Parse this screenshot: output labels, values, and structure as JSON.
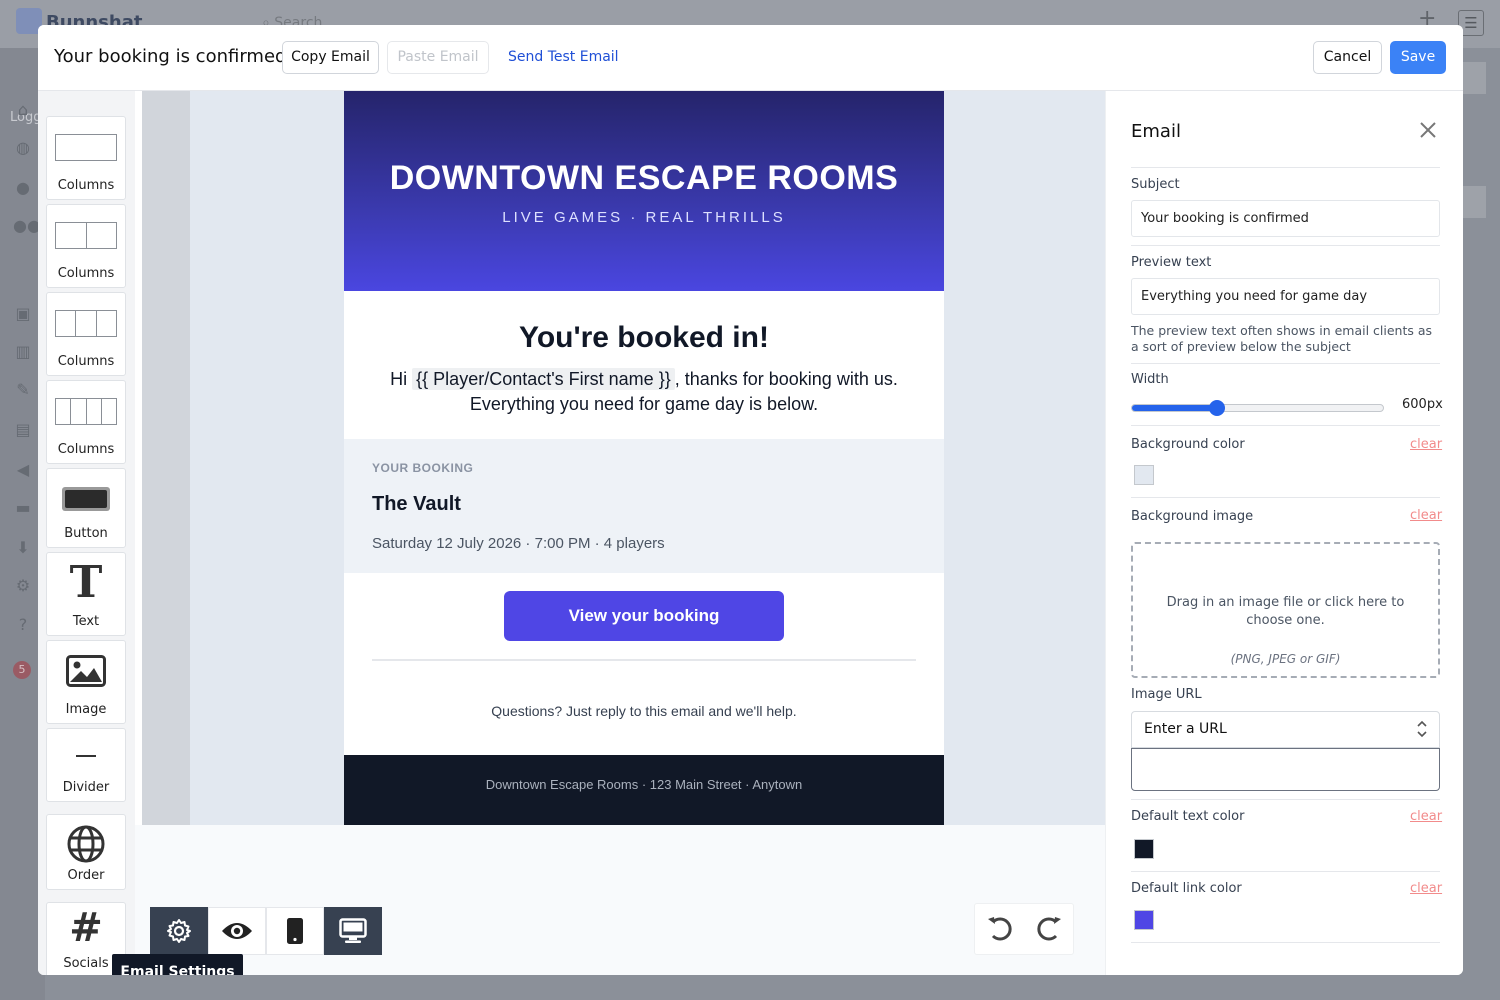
{
  "background_app": {
    "brand": "Bunnshat",
    "search_placeholder": "Search",
    "sidebar_label": "Logg",
    "notification_count": "5",
    "plus": "+",
    "menu": "☰"
  },
  "header": {
    "title": "Your booking is confirmed",
    "copy_email": "Copy Email",
    "paste_email": "Paste Email",
    "send_test": "Send Test Email",
    "cancel": "Cancel",
    "save": "Save"
  },
  "blocks": [
    {
      "label": "Columns",
      "icon": "one-column-icon"
    },
    {
      "label": "Columns",
      "icon": "two-columns-icon"
    },
    {
      "label": "Columns",
      "icon": "three-columns-icon"
    },
    {
      "label": "Columns",
      "icon": "four-columns-icon"
    },
    {
      "label": "Button",
      "icon": "button-icon"
    },
    {
      "label": "Text",
      "icon": "text-icon"
    },
    {
      "label": "Image",
      "icon": "image-icon"
    },
    {
      "label": "Divider",
      "icon": "divider-icon"
    },
    {
      "label": "Order",
      "icon": "globe-icon"
    },
    {
      "label": "Socials",
      "icon": "hash-icon"
    }
  ],
  "email": {
    "hero_title": "DOWNTOWN ESCAPE ROOMS",
    "hero_subtitle": "LIVE GAMES · REAL THRILLS",
    "greeting_title": "You're booked in!",
    "greeting_hi": "Hi",
    "merge_field": "{{  Player/Contact's First name }}",
    "greeting_rest": ", thanks for booking with us.",
    "greeting_line2": "Everything you need for game day is below.",
    "booking_label": "YOUR BOOKING",
    "booking_name": "The Vault",
    "booking_details": "Saturday 12 July 2026  ·  7:00 PM  ·  4 players",
    "cta_label": "View your booking",
    "questions": "Questions? Just reply to this email and we'll help.",
    "footer": "Downtown Escape Rooms  ·  123 Main Street  ·  Anytown"
  },
  "toolbar": {
    "tooltip": "Email Settings",
    "buttons": [
      "settings-icon",
      "eye-icon",
      "mobile-icon",
      "desktop-icon"
    ],
    "active": [
      "settings",
      "desktop"
    ]
  },
  "panel": {
    "title": "Email",
    "subject_label": "Subject",
    "subject_value": "Your booking is confirmed",
    "preview_label": "Preview text",
    "preview_value": "Everything you need for game day",
    "preview_help": "The preview text often shows in email clients as a sort of preview below the subject",
    "width_label": "Width",
    "width_value": "600px",
    "width_slider_fraction": 0.34,
    "bg_color_label": "Background color",
    "bg_image_label": "Background image",
    "clear": "clear",
    "dropzone_text": "Drag in an image file or click here to choose one.",
    "dropzone_formats": "(PNG, JPEG or GIF)",
    "image_url_label": "Image URL",
    "image_url_select": "Enter a URL",
    "text_color_label": "Default text color",
    "link_color_label": "Default link color"
  },
  "colors": {
    "save_button": "#3b82f6",
    "hero_gradient_start": "#25246b",
    "hero_gradient_end": "#4a46e0",
    "cta": "#4f46e5",
    "footer": "#111827",
    "background_swatch": "#e2e8f0",
    "text_swatch": "#111827",
    "link_swatch": "#4f46e5",
    "clear_link": "#f28b8b"
  }
}
